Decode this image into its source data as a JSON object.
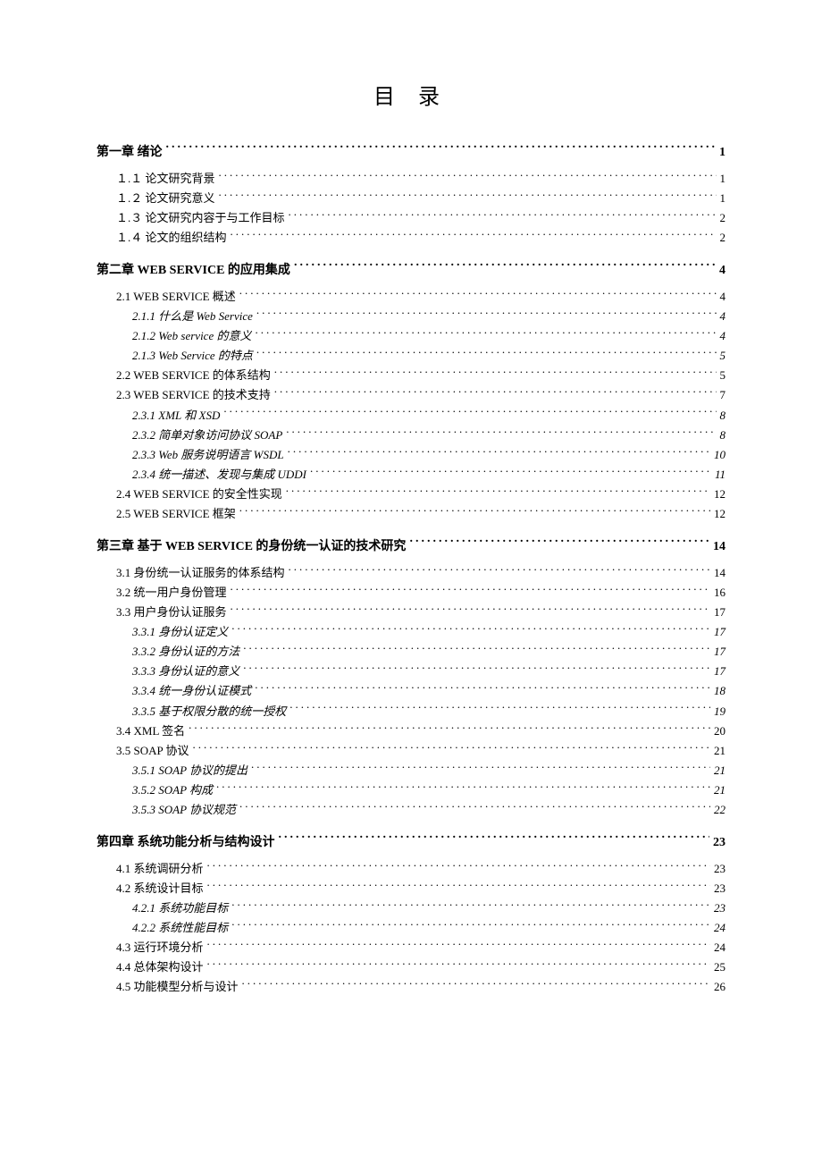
{
  "title": "目 录",
  "toc": [
    {
      "type": "chapter",
      "label": "第一章  绪论",
      "page": "1"
    },
    {
      "type": "section",
      "label": "１.１ 论文研究背景",
      "page": "1"
    },
    {
      "type": "section",
      "label": "１.２ 论文研究意义",
      "page": "1"
    },
    {
      "type": "section",
      "label": "１.３ 论文研究内容于与工作目标",
      "page": "2"
    },
    {
      "type": "section",
      "label": "１.４ 论文的组织结构",
      "page": "2"
    },
    {
      "type": "chapter",
      "label": "第二章  WEB SERVICE 的应用集成",
      "page": "4"
    },
    {
      "type": "section",
      "label": "2.1 WEB SERVICE 概述",
      "page": "4",
      "smallcaps": true
    },
    {
      "type": "sub",
      "label": "2.1.1 什么是 Web Service",
      "page": "4"
    },
    {
      "type": "sub",
      "label": "2.1.2 Web service 的意义",
      "page": "4"
    },
    {
      "type": "sub",
      "label": "2.1.3 Web Service 的特点",
      "page": "5"
    },
    {
      "type": "section",
      "label": "2.2 WEB SERVICE 的体系结构",
      "page": "5",
      "smallcaps": true
    },
    {
      "type": "section",
      "label": "2.3 WEB SERVICE 的技术支持",
      "page": "7",
      "smallcaps": true
    },
    {
      "type": "sub",
      "label": "2.3.1 XML 和 XSD",
      "page": "8"
    },
    {
      "type": "sub",
      "label": "2.3.2 简单对象访问协议 SOAP",
      "page": "8"
    },
    {
      "type": "sub",
      "label": "2.3.3 Web 服务说明语言 WSDL",
      "page": "10"
    },
    {
      "type": "sub",
      "label": "2.3.4 统一描述、发现与集成 UDDI",
      "page": "11"
    },
    {
      "type": "section",
      "label": "2.4 WEB SERVICE 的安全性实现",
      "page": "12",
      "smallcaps": true
    },
    {
      "type": "section",
      "label": "2.5 WEB SERVICE 框架",
      "page": "12",
      "smallcaps": true
    },
    {
      "type": "chapter",
      "label": "第三章 基于 WEB SERVICE 的身份统一认证的技术研究",
      "page": "14"
    },
    {
      "type": "section",
      "label": "3.1 身份统一认证服务的体系结构",
      "page": "14"
    },
    {
      "type": "section",
      "label": "3.2 统一用户身份管理",
      "page": "16"
    },
    {
      "type": "section",
      "label": "3.3 用户身份认证服务",
      "page": "17"
    },
    {
      "type": "sub",
      "label": "3.3.1 身份认证定义",
      "page": "17"
    },
    {
      "type": "sub",
      "label": "3.3.2 身份认证的方法",
      "page": "17"
    },
    {
      "type": "sub",
      "label": "3.3.3 身份认证的意义",
      "page": "17"
    },
    {
      "type": "sub",
      "label": "3.3.4 统一身份认证模式",
      "page": "18"
    },
    {
      "type": "sub",
      "label": "3.3.5 基于权限分散的统一授权",
      "page": "19"
    },
    {
      "type": "section",
      "label": "3.4 XML 签名",
      "page": "20"
    },
    {
      "type": "section",
      "label": "3.5 SOAP 协议",
      "page": "21"
    },
    {
      "type": "sub",
      "label": "3.5.1 SOAP 协议的提出",
      "page": "21"
    },
    {
      "type": "sub",
      "label": "3.5.2 SOAP 构成",
      "page": "21"
    },
    {
      "type": "sub",
      "label": "3.5.3 SOAP 协议规范",
      "page": "22"
    },
    {
      "type": "chapter",
      "label": "第四章 系统功能分析与结构设计",
      "page": "23"
    },
    {
      "type": "section",
      "label": "4.1 系统调研分析",
      "page": "23"
    },
    {
      "type": "section",
      "label": "4.2 系统设计目标",
      "page": "23"
    },
    {
      "type": "sub",
      "label": "4.2.1 系统功能目标",
      "page": "23"
    },
    {
      "type": "sub",
      "label": "4.2.2 系统性能目标",
      "page": "24"
    },
    {
      "type": "section",
      "label": "4.3 运行环境分析",
      "page": "24"
    },
    {
      "type": "section",
      "label": "4.4 总体架构设计",
      "page": "25"
    },
    {
      "type": "section",
      "label": "4.5 功能模型分析与设计",
      "page": "26"
    }
  ]
}
